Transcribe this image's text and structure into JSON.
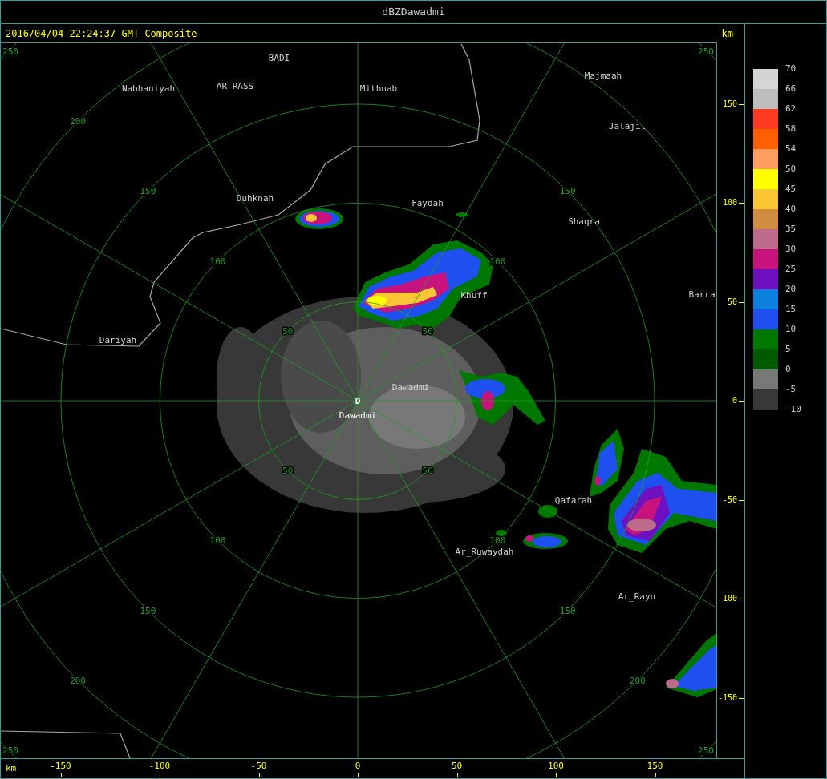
{
  "window": {
    "title": "dBZDawadmi"
  },
  "header": {
    "timestamp": "2016/04/04 22:24:37 GMT Composite",
    "unit": "km"
  },
  "map": {
    "range_rings": [
      {
        "labels": [
          "50",
          "50",
          "50",
          "50"
        ]
      },
      {
        "labels": [
          "100",
          "100",
          "100",
          "100"
        ]
      },
      {
        "labels": [
          "150",
          "150",
          "150",
          "150"
        ]
      },
      {
        "labels": [
          "200",
          "200",
          "200"
        ]
      },
      {
        "labels": [
          "250",
          "250",
          "250",
          "250"
        ]
      }
    ],
    "site": {
      "marker": "D",
      "name": "Dawadmi"
    },
    "cities": [
      {
        "name": "BADI"
      },
      {
        "name": "Nabhaniyah"
      },
      {
        "name": "AR_RASS"
      },
      {
        "name": "Mithnab"
      },
      {
        "name": "Majmaah"
      },
      {
        "name": "Jalajil"
      },
      {
        "name": "Duhknah"
      },
      {
        "name": "Faydah"
      },
      {
        "name": "Shaqra"
      },
      {
        "name": "Khuff"
      },
      {
        "name": "Barra"
      },
      {
        "name": "Dariyah"
      },
      {
        "name": "Dawadmi"
      },
      {
        "name": "Qafarah"
      },
      {
        "name": "Ar_Ruwaydah"
      },
      {
        "name": "Ar_Rayn"
      }
    ]
  },
  "y_axis": {
    "ticks": [
      "150",
      "100",
      "50",
      "0",
      "-50",
      "-100",
      "-150"
    ]
  },
  "x_axis": {
    "unit": "km",
    "ticks": [
      "-150",
      "-100",
      "-50",
      "0",
      "50",
      "100",
      "150"
    ]
  },
  "legend": {
    "labels": [
      "70",
      "66",
      "62",
      "58",
      "54",
      "50",
      "45",
      "40",
      "35",
      "30",
      "25",
      "20",
      "15",
      "10",
      "5",
      "0",
      "-5",
      "-10"
    ],
    "bins": [
      {
        "color": "#d4d4d4"
      },
      {
        "color": "#bdbdbd"
      },
      {
        "color": "#ff3a20"
      },
      {
        "color": "#ff5f00"
      },
      {
        "color": "#ff9d5e"
      },
      {
        "color": "#ffff00"
      },
      {
        "color": "#fbc634"
      },
      {
        "color": "#d18c40"
      },
      {
        "color": "#bc6c8a"
      },
      {
        "color": "#c8127e"
      },
      {
        "color": "#6e10c0"
      },
      {
        "color": "#0b80dc"
      },
      {
        "color": "#1e50f0"
      },
      {
        "color": "#007800"
      },
      {
        "color": "#005a00"
      },
      {
        "color": "#787878"
      },
      {
        "color": "#383838"
      }
    ]
  }
}
